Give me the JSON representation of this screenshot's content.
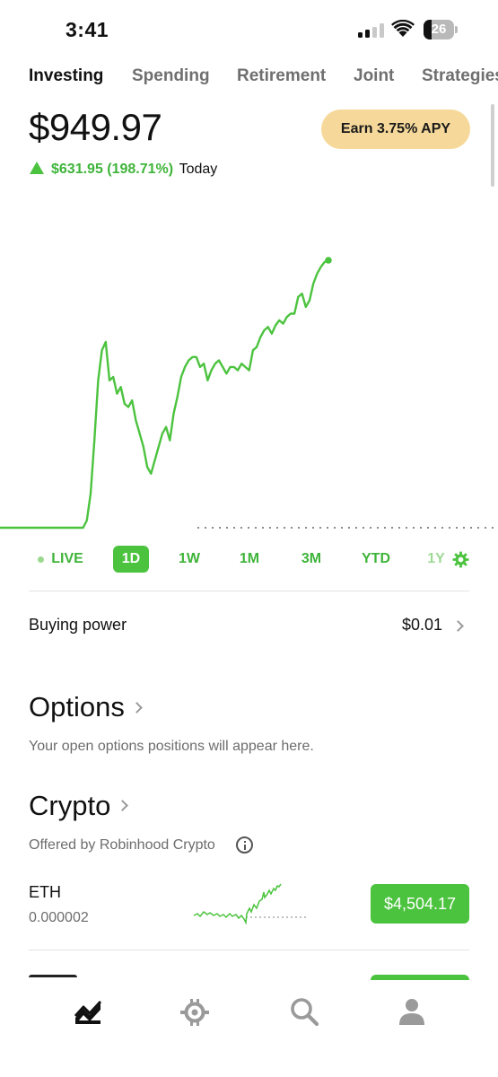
{
  "status_bar": {
    "time": "3:41",
    "battery_level": "26"
  },
  "tabs": [
    {
      "label": "Investing",
      "active": true
    },
    {
      "label": "Spending",
      "active": false
    },
    {
      "label": "Retirement",
      "active": false
    },
    {
      "label": "Joint",
      "active": false
    },
    {
      "label": "Strategies",
      "active": false
    }
  ],
  "portfolio": {
    "balance": "$949.97",
    "apy_button": "Earn 3.75% APY",
    "change_value": "$631.95 (198.71%)",
    "change_period": "Today"
  },
  "colors": {
    "accent_green": "#4cc33f",
    "apy_gold": "#f6d99a"
  },
  "chart_data": {
    "type": "line",
    "series": [
      {
        "values": [
          318,
          318,
          318,
          318,
          318,
          318,
          318,
          318,
          318,
          318,
          318,
          318,
          318,
          318,
          318,
          318,
          318,
          318,
          318,
          318,
          318,
          318,
          318,
          340,
          420,
          580,
          760,
          850,
          875,
          760,
          770,
          720,
          740,
          690,
          680,
          700,
          640,
          600,
          560,
          500,
          480,
          520,
          560,
          600,
          620,
          580,
          660,
          710,
          770,
          800,
          820,
          830,
          830,
          800,
          810,
          760,
          790,
          810,
          820,
          800,
          780,
          800,
          800,
          790,
          810,
          800,
          790,
          850,
          860,
          890,
          910,
          920,
          900,
          925,
          940,
          930,
          950,
          960,
          960,
          1010,
          1020,
          980,
          1000,
          1050,
          1080,
          1100,
          1115,
          1120
        ]
      }
    ],
    "baseline_visible": true,
    "grid": false
  },
  "ranges": {
    "live": "LIVE",
    "d1": "1D",
    "w1": "1W",
    "m1": "1M",
    "m3": "3M",
    "ytd": "YTD",
    "y1": "1Y",
    "selected": "1D"
  },
  "buying_power": {
    "label": "Buying power",
    "value": "$0.01"
  },
  "options": {
    "title": "Options",
    "subtitle": "Your open options positions will appear here."
  },
  "crypto": {
    "title": "Crypto",
    "subtitle": "Offered by Robinhood Crypto",
    "items": [
      {
        "symbol": "ETH",
        "quantity": "0.000002",
        "price": "$4,504.17"
      }
    ]
  },
  "nav": {
    "icons": [
      "investing-icon",
      "crypto-icon",
      "search-icon",
      "account-icon"
    ]
  }
}
